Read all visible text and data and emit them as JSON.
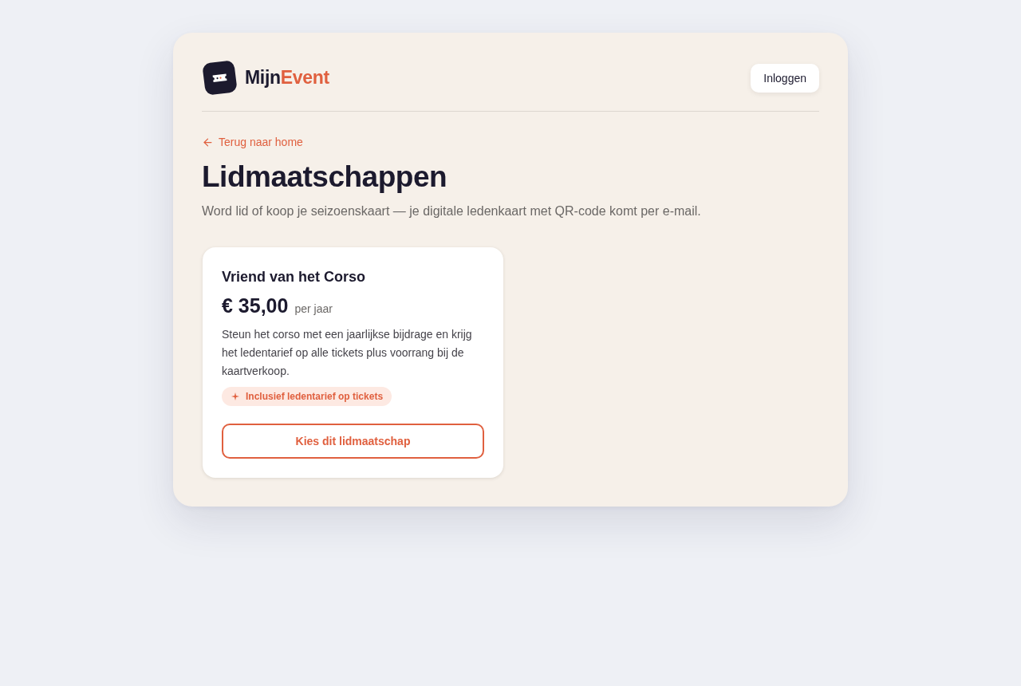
{
  "brand": {
    "name_start": "Mijn",
    "name_accent": "Event"
  },
  "header": {
    "login_button": "Inloggen"
  },
  "back_link": "Terug naar home",
  "page": {
    "title": "Lidmaatschappen",
    "subtitle": "Word lid of koop je seizoenskaart — je digitale ledenkaart met QR-code komt per e-mail."
  },
  "plans": [
    {
      "name": "Vriend van het Corso",
      "price": "€ 35,00",
      "period": "per jaar",
      "description": "Steun het corso met een jaarlijkse bijdrage en krijg het ledentarief op alle tickets plus voorrang bij de kaartverkoop.",
      "badge": "Inclusief ledentarief op tickets",
      "button": "Kies dit lidmaatschap"
    }
  ]
}
